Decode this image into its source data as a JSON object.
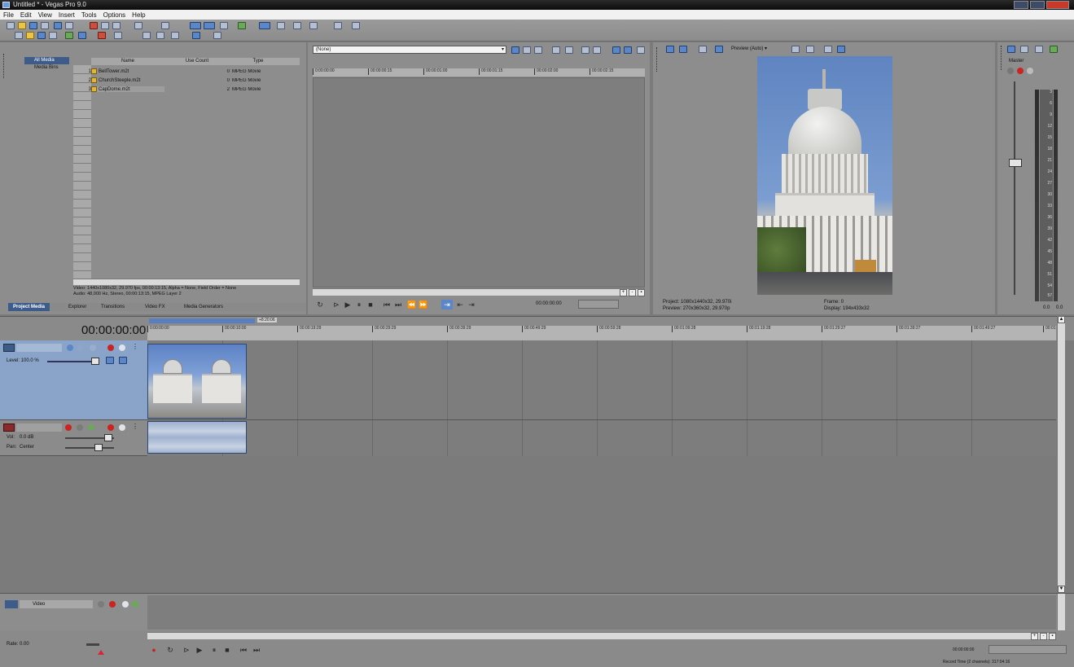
{
  "window": {
    "title": "Untitled * - Vegas Pro 9.0"
  },
  "menu": [
    "File",
    "Edit",
    "View",
    "Insert",
    "Tools",
    "Options",
    "Help"
  ],
  "project_media": {
    "tree": [
      "All Media",
      "Media Bins"
    ],
    "columns": [
      "Name",
      "Use Count",
      "Type"
    ],
    "files": [
      {
        "idx": "1",
        "name": "BellTower.m2t",
        "count": "0",
        "type": "MPEG Movie"
      },
      {
        "idx": "2",
        "name": "ChurchSteeple.m2t",
        "count": "0",
        "type": "MPEG Movie"
      },
      {
        "idx": "3",
        "name": "CapDome.m2t",
        "count": "2",
        "type": "MPEG Movie"
      }
    ],
    "info_line1": "Video: 1440x1080x32, 29.970 fps, 00:00:13:15, Alpha = None, Field Order = None",
    "info_line2": "Audio: 48,000 Hz, Stereo, 00:00:13:15, MPEG Layer 2",
    "tabs": [
      "Project Media",
      "Explorer",
      "Transitions",
      "Video FX",
      "Media Generators"
    ]
  },
  "trimmer": {
    "dropdown": "(None)",
    "ruler": [
      "0:00:00:00",
      "00:00:00:15",
      "00:00:01:00",
      "00:00:01:15",
      "00:00:02:00",
      "00:00:02:15"
    ],
    "timecode": "00:00:00:00"
  },
  "preview": {
    "mode": "Preview (Auto)",
    "project_label": "Project:",
    "project_val": "1080x1440x32, 29.970i",
    "preview_label": "Preview:",
    "preview_val": "270x360x32, 29.970p",
    "frame_label": "Frame:",
    "frame_val": "0",
    "display_label": "Display:",
    "display_val": "194x433x32"
  },
  "master": {
    "label": "Master",
    "scale": [
      "3",
      "6",
      "9",
      "12",
      "15",
      "18",
      "21",
      "24",
      "27",
      "30",
      "33",
      "36",
      "39",
      "42",
      "45",
      "48",
      "51",
      "54",
      "57"
    ],
    "footer": [
      "0.0",
      "0.0"
    ]
  },
  "timeline": {
    "timecode": "00:00:00:00",
    "loop_marker": "+8:20:06",
    "ruler": [
      "0:00:00:00",
      "00:00:10:00",
      "00:00:19:29",
      "00:00:29:29",
      "00:00:39:29",
      "00:00:49:29",
      "00:00:59:28",
      "00:01:09:28",
      "00:01:19:28",
      "00:01:29:27",
      "00:01:39:27",
      "00:01:49:27",
      "00:01"
    ],
    "video_track": {
      "label": "Level: 100.0 %"
    },
    "audio_track": {
      "vol_label": "Vol:",
      "vol_val": "0.0 dB",
      "pan_label": "Pan:",
      "pan_val": "Center"
    },
    "bus_track": {
      "label": "Video"
    },
    "rate": "Rate: 0.00",
    "end_time": "00:00:00:00",
    "record_time": "Record Time (2 channels): 317:04:16"
  },
  "colors": {
    "selected_track": "#89a4c8",
    "accent": "#3e5c8a",
    "record": "#cc2222"
  }
}
